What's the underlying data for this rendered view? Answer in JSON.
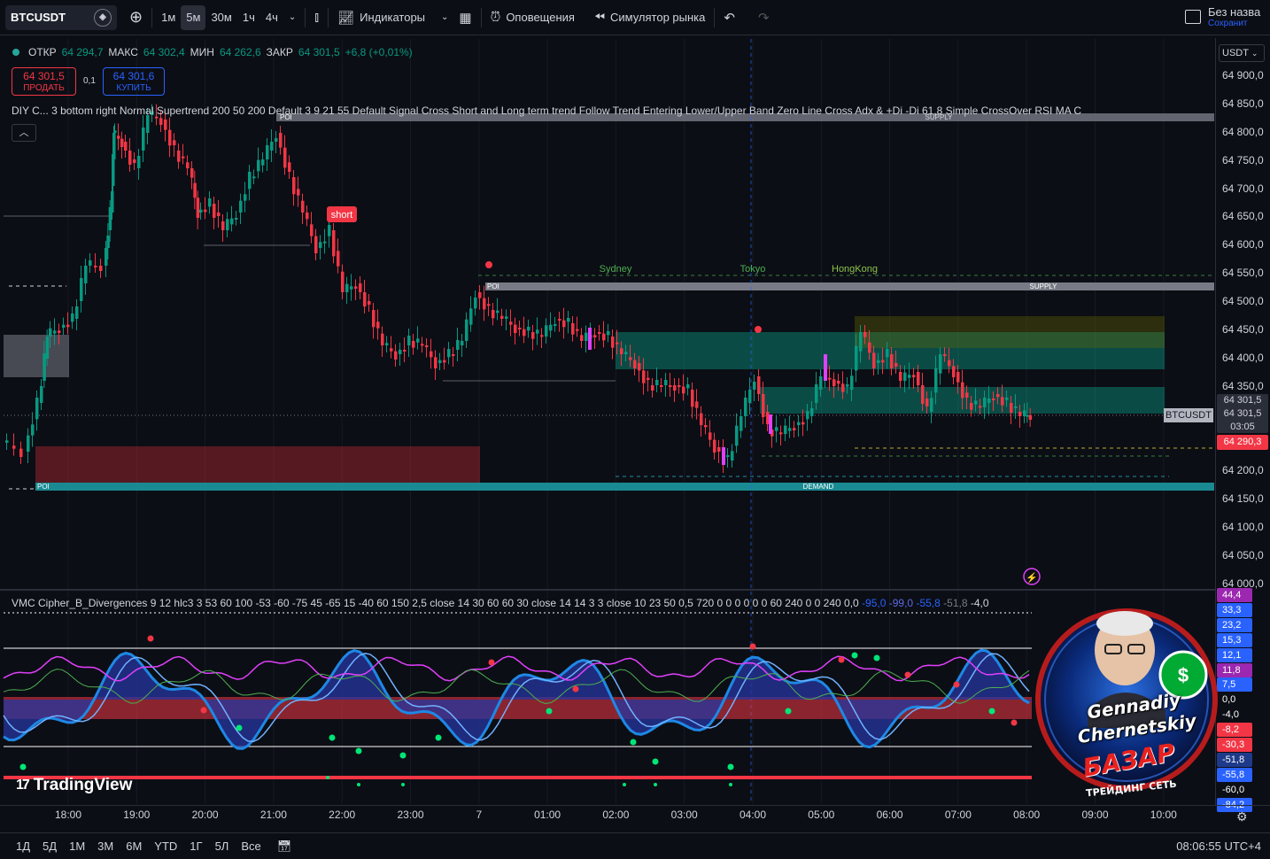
{
  "toolbar": {
    "symbol": "BTCUSDT",
    "intervals": [
      "1м",
      "5м",
      "30м",
      "1ч",
      "4ч"
    ],
    "active_interval": "5м",
    "indicators_label": "Индикаторы",
    "alerts_label": "Оповещения",
    "replay_label": "Симулятор рынка",
    "layout_name": "Без назва",
    "layout_saved": "Сохранит"
  },
  "legend": {
    "open_label": "ОТКР",
    "open": "64 294,7",
    "high_label": "МАКС",
    "high": "64 302,4",
    "low_label": "МИН",
    "low": "64 262,6",
    "close_label": "ЗАКР",
    "close": "64 301,5",
    "change": "+6,8 (+0,01%)"
  },
  "trade": {
    "sell_price": "64 301,5",
    "sell_label": "ПРОДАТЬ",
    "spread": "0,1",
    "buy_price": "64 301,6",
    "buy_label": "КУПИТЬ"
  },
  "indicator_title": "DIY C... 3 bottom right Normal Supertrend 200 50 200 Default 3 9 21 55 Default Signal Cross Short and Long term trend Follow Trend Entering Lower/Upper Band Zero Line Cross Adx & +Di -Di 61,8 Simple CrossOver RSI MA C",
  "chart_labels": {
    "poi": "POI",
    "supply": "SUPPLY",
    "demand": "DEMAND",
    "short": "short",
    "sydney": "Sydney",
    "tokyo": "Tokyo",
    "hongkong": "HongKong"
  },
  "price_axis": {
    "currency": "USDT",
    "labels": [
      "64 900,0",
      "64 850,0",
      "64 800,0",
      "64 750,0",
      "64 700,0",
      "64 650,0",
      "64 600,0",
      "64 550,0",
      "64 500,0",
      "64 450,0",
      "64 400,0",
      "64 350,0",
      "64 301,5",
      "64 200,0",
      "64 150,0",
      "64 100,0",
      "64 050,0",
      "64 000,0"
    ],
    "last_price": "64 301,5",
    "countdown": "03:05",
    "bid_price": "64 301,5",
    "low_tag": "64 290,3",
    "symbol_tag": "BTCUSDT"
  },
  "oscillator": {
    "title": "VMC Cipher_B_Divergences 9 12 hlc3 3 53 60 100 -53 -60 -75 45 -65 15 -40 60 150 2,5 close 14 30 60 60 30 close 14 14 3 3 close 10 23 50 0,5 720 0 0 0 0 0 0 60 240 0 0 240",
    "val1": "0,0",
    "val2": "-95,0",
    "val3": "-99,0",
    "val4": "-55,8",
    "val5": "-51,8",
    "val6": "-4,0",
    "scale": [
      "44,4",
      "33,3",
      "23,2",
      "15,3",
      "12,1",
      "11,8",
      "7,5",
      "0,0",
      "-4,0",
      "-8,2",
      "-30,3",
      "-51,8",
      "-55,8",
      "-60,0",
      "-84,2"
    ]
  },
  "time_axis": [
    "18:00",
    "19:00",
    "20:00",
    "21:00",
    "22:00",
    "23:00",
    "7",
    "01:00",
    "02:00",
    "03:00",
    "04:00",
    "05:00",
    "06:00",
    "07:00",
    "08:00",
    "09:00",
    "10:00"
  ],
  "ranges": [
    "1Д",
    "5Д",
    "1М",
    "3М",
    "6М",
    "YTD",
    "1Г",
    "5Л",
    "Все"
  ],
  "clock": "08:06:55 UTC+4",
  "watermark": "TradingView",
  "badge": {
    "name": "Gennadiy Chernetskiy",
    "brand": "БАЗАР",
    "subtitle": "ТРЕЙДИНГ СЕТЬ"
  },
  "colors": {
    "up": "#089981",
    "down": "#f23645",
    "accent": "#2962ff",
    "background": "#0c0e15"
  }
}
